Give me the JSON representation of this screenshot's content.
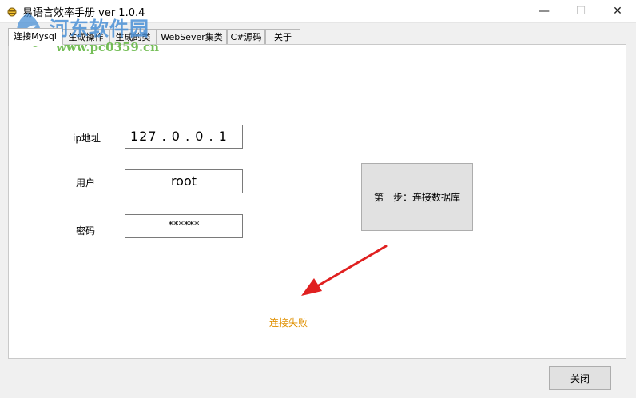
{
  "window": {
    "title": "易语言效率手册 ver 1.0.4",
    "min_glyph": "—",
    "max_glyph": "☐",
    "close_glyph": "✕"
  },
  "watermark": {
    "line1": "河东软件园",
    "line2": "www.pc0359.cn"
  },
  "tabs": [
    {
      "label": "连接Mysql",
      "active": true
    },
    {
      "label": "生成操作",
      "active": false
    },
    {
      "label": "生成的类",
      "active": false
    },
    {
      "label": "WebSever集类",
      "active": false
    },
    {
      "label": "C#源码",
      "active": false
    },
    {
      "label": "关于",
      "active": false
    }
  ],
  "form": {
    "ip_label": "ip地址",
    "ip_value": "127 . 0 . 0 . 1",
    "user_label": "用户",
    "user_value": "root",
    "password_label": "密码",
    "password_value": "******"
  },
  "connect_button": "第一步：连接数据库",
  "status_text": "连接失败",
  "close_button": "关闭",
  "colors": {
    "status": "#e09000",
    "arrow": "#e02020",
    "watermark_blue": "#4a90d6",
    "watermark_green": "#5db33b"
  }
}
